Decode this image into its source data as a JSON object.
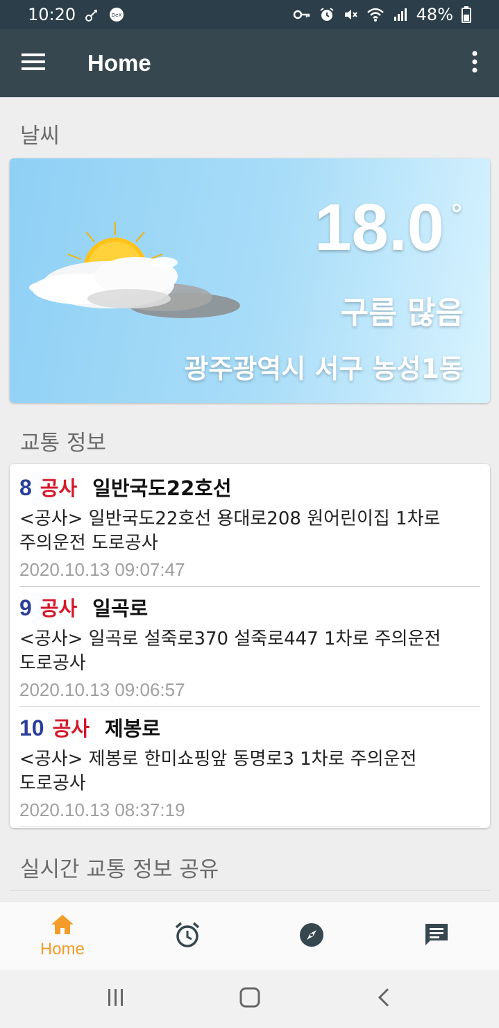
{
  "status_bar": {
    "time": "10:20",
    "battery": "48%",
    "left_icons": [
      "key-link-icon",
      "dex-icon"
    ],
    "right_icons": [
      "vpn-key-icon",
      "alarm-icon",
      "mute-icon",
      "wifi-icon",
      "signal-icon",
      "battery-icon"
    ]
  },
  "app_bar": {
    "title": "Home",
    "menu_icon": "hamburger-menu-icon",
    "more_icon": "more-vert-icon"
  },
  "weather": {
    "section_title": "날씨",
    "temperature": "18.0",
    "degree_symbol": "°",
    "condition": "구름 많음",
    "location": "광주광역시 서구 농성1동",
    "icon": "partly-cloudy-sun-icon"
  },
  "traffic": {
    "section_title": "교통 정보",
    "items": [
      {
        "number": "8",
        "type": "공사",
        "road": "일반국도22호선",
        "description_line1": "<공사> 일반국도22호선 용대로208 원어린이집 1차로",
        "description_line2": "주의운전 도로공사",
        "time": "2020.10.13 09:07:47"
      },
      {
        "number": "9",
        "type": "공사",
        "road": "일곡로",
        "description_line1": "<공사> 일곡로 설죽로370 설죽로447 1차로 주의운전",
        "description_line2": "도로공사",
        "time": "2020.10.13 09:06:57"
      },
      {
        "number": "10",
        "type": "공사",
        "road": "제봉로",
        "description_line1": "<공사> 제봉로 한미쇼핑앞 동명로3 1차로 주의운전",
        "description_line2": "도로공사",
        "time": "2020.10.13 08:37:19"
      }
    ]
  },
  "share": {
    "section_title": "실시간 교통 정보 공유"
  },
  "bottom_nav": {
    "items": [
      {
        "label": "Home",
        "icon": "home-icon",
        "active": true
      },
      {
        "label": "",
        "icon": "alarm-clock-icon",
        "active": false
      },
      {
        "label": "",
        "icon": "compass-icon",
        "active": false
      },
      {
        "label": "",
        "icon": "chat-message-icon",
        "active": false
      }
    ]
  },
  "colors": {
    "status_bar": "#2b3e4a",
    "app_bar": "#37474f",
    "accent": "#f39c29",
    "traffic_number": "#2b3f9a",
    "traffic_type": "#d6172a",
    "nav_icon": "#37474f"
  }
}
